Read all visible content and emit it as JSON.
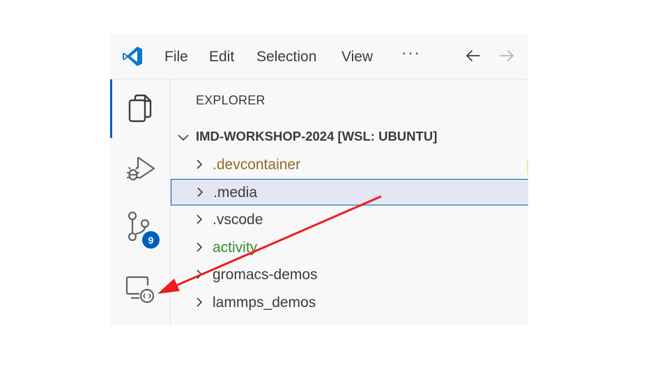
{
  "menu": {
    "file": "File",
    "edit": "Edit",
    "selection": "Selection",
    "view": "View",
    "more": "···"
  },
  "activity": {
    "badge_count": "9",
    "icons": [
      "explorer-icon",
      "run-debug-icon",
      "source-control-icon",
      "remote-explorer-icon"
    ]
  },
  "explorer": {
    "title": "EXPLORER",
    "root": "IMD-WORKSHOP-2024 [WSL: UBUNTU]",
    "items": [
      {
        "label": ".devcontainer",
        "color": "#8e6b23"
      },
      {
        "label": ".media",
        "color": "#3b3b3b"
      },
      {
        "label": ".vscode",
        "color": "#3b3b3b"
      },
      {
        "label": "activity",
        "color": "#388a34"
      },
      {
        "label": "gromacs-demos",
        "color": "#3b3b3b"
      },
      {
        "label": "lammps_demos",
        "color": "#3b3b3b"
      }
    ]
  },
  "colors": {
    "accent": "#005fb8",
    "annotation_arrow": "#ee1c1c",
    "selection_bg": "#e4e6f1"
  }
}
